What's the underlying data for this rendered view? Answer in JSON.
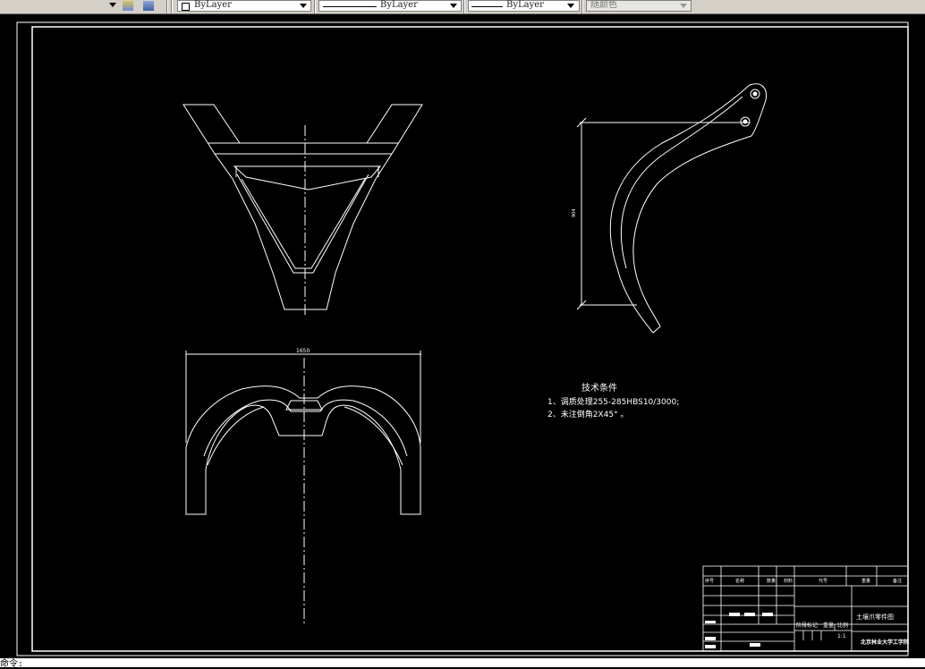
{
  "toolbar": {
    "layer_value": "ByLayer",
    "linetype_value": "ByLayer",
    "lineweight_value": "ByLayer",
    "plotstyle_value": "随颜色"
  },
  "drawing": {
    "dim_width": "1650",
    "dim_height": "904",
    "notes_title": "技术条件",
    "note_1": "1、调质处理255-285HBS10/3000;",
    "note_2": "2、未注倒角2X45°  。"
  },
  "title_block": {
    "h_seq": "序号",
    "h_name": "名称",
    "h_qty": "数量",
    "h_mat": "材料",
    "h_code": "代号",
    "h_weight": "重量",
    "h_remark": "备注",
    "part_title": "土壤爪零件图",
    "stage_mark": "阶段标记",
    "weight_label": "重量",
    "scale_label": "比例",
    "scale_value": "1:1",
    "school": "北京林业大学工学院"
  },
  "command_line": {
    "prompt": "命令:"
  }
}
